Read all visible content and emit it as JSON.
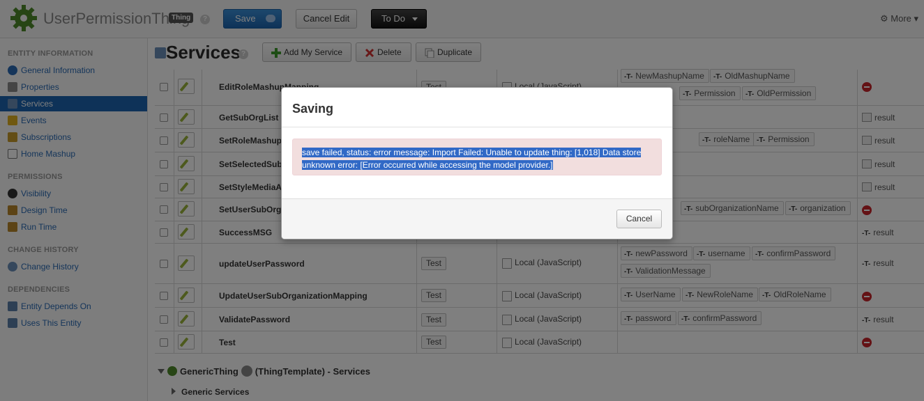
{
  "header": {
    "app_title": "UserPermissionThing",
    "thing_badge": "Thing",
    "help": "?",
    "save_label": "Save",
    "cancel_label": "Cancel Edit",
    "todo_label": "To Do",
    "more_label": "More"
  },
  "sidebar": {
    "sections": [
      {
        "title": "ENTITY INFORMATION",
        "items": [
          "General Information",
          "Properties",
          "Services",
          "Events",
          "Subscriptions",
          "Home Mashup"
        ]
      },
      {
        "title": "PERMISSIONS",
        "items": [
          "Visibility",
          "Design Time",
          "Run Time"
        ]
      },
      {
        "title": "CHANGE HISTORY",
        "items": [
          "Change History"
        ]
      },
      {
        "title": "DEPENDENCIES",
        "items": [
          "Entity Depends On",
          "Uses This Entity"
        ]
      }
    ],
    "active_item": "Services"
  },
  "page": {
    "title": "Services",
    "help": "?",
    "add_label": "Add My Service",
    "delete_label": "Delete",
    "duplicate_label": "Duplicate"
  },
  "services": [
    {
      "name": "EditRoleMashupMapping",
      "test": "Test",
      "handler": "Local (JavaScript)",
      "params": [
        "NewMashupName",
        "OldMashupName",
        "Permission",
        "OldPermission"
      ],
      "result": ""
    },
    {
      "name": "GetSubOrgList",
      "test": "",
      "handler": "",
      "params": [],
      "result": "result"
    },
    {
      "name": "SetRoleMashup",
      "test": "",
      "handler": "",
      "params": [
        "roleName",
        "Permission"
      ],
      "result": "result"
    },
    {
      "name": "SetSelectedSub",
      "test": "",
      "handler": "",
      "params": [],
      "result": "result"
    },
    {
      "name": "SetStyleMediaA",
      "test": "",
      "handler": "",
      "params": [],
      "result": "result"
    },
    {
      "name": "SetUserSubOrga",
      "test": "",
      "handler": "",
      "params": [
        "subOrganizationName",
        "organization"
      ],
      "result": ""
    },
    {
      "name": "SuccessMSG",
      "test": "",
      "handler": "",
      "params": [],
      "result": "result"
    },
    {
      "name": "updateUserPassword",
      "test": "Test",
      "handler": "Local (JavaScript)",
      "params": [
        "newPassword",
        "username",
        "confirmPassword",
        "ValidationMessage"
      ],
      "result": "result"
    },
    {
      "name": "UpdateUserSubOrganizationMapping",
      "test": "Test",
      "handler": "Local (JavaScript)",
      "params": [
        "UserName",
        "NewRoleName",
        "OldRoleName"
      ],
      "result": ""
    },
    {
      "name": "ValidatePassword",
      "test": "Test",
      "handler": "Local (JavaScript)",
      "params": [
        "password",
        "confirmPassword"
      ],
      "result": "result"
    },
    {
      "name": "Test",
      "test": "Test",
      "handler": "Local (JavaScript)",
      "params": [],
      "result": ""
    }
  ],
  "param_type_mark": "-T-",
  "generic": {
    "name": "GenericThing",
    "suffix": "(ThingTemplate) - Services",
    "sub": "Generic Services"
  },
  "modal": {
    "title": "Saving",
    "message": "save failed, status: error message: Import Failed: Unable to update thing: [1,018] Data store unknown error: [Error occurred while accessing the model provider.]",
    "cancel_label": "Cancel"
  },
  "colors": {
    "accent": "#1d65b0",
    "error_bg": "#f2dede",
    "selection": "#3169c6",
    "delete_red": "#c9242b"
  }
}
